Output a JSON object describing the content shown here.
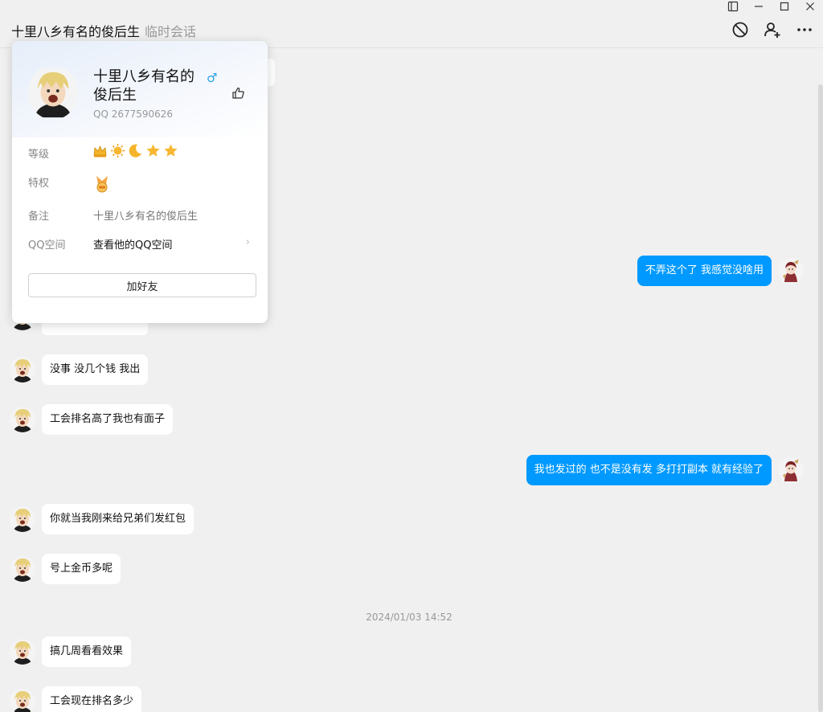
{
  "header": {
    "title": "十里八乡有名的俊后生",
    "subtitle": "临时会话"
  },
  "icons": {
    "sidebar": "sidebar-toggle-icon",
    "minimize": "minimize-icon",
    "maximize": "maximize-icon",
    "close": "close-icon",
    "block": "block-icon",
    "add_friend": "add-user-icon",
    "more": "more-icon",
    "like": "thumbs-up-icon",
    "gender": "male-icon"
  },
  "profile_card": {
    "name": "十里八乡有名的俊后生",
    "gender_symbol": "♂",
    "qq": "QQ 2677590626",
    "level_label": "等级",
    "privilege_label": "特权",
    "remark_label": "备注",
    "remark_value": "十里八乡有名的俊后生",
    "qzone_label": "QQ空间",
    "qzone_value": "查看他的QQ空间",
    "qzone_arrow": "›",
    "add_friend_button": "加好友"
  },
  "messages": [
    {
      "side": "right",
      "text": "不弄这个了   我感觉没啥用"
    },
    {
      "side": "left",
      "text": "没事 没几个钱 我出"
    },
    {
      "side": "left",
      "text": "工会排名高了我也有面子"
    },
    {
      "side": "right",
      "text": "我也发过的    也不是没有发   多打打副本    就有经验了"
    },
    {
      "side": "left",
      "text": "你就当我刚来给兄弟们发红包"
    },
    {
      "side": "left",
      "text": "号上金币多呢"
    },
    {
      "side": "left",
      "text": "搞几周看看效果"
    },
    {
      "side": "left",
      "text": "工会现在排名多少"
    }
  ],
  "timestamp": "2024/01/03 14:52",
  "colors": {
    "background": "#f0f0f0",
    "bubble_self": "#0099ff",
    "bubble_other": "#ffffff",
    "gender": "#2aa3e8"
  }
}
